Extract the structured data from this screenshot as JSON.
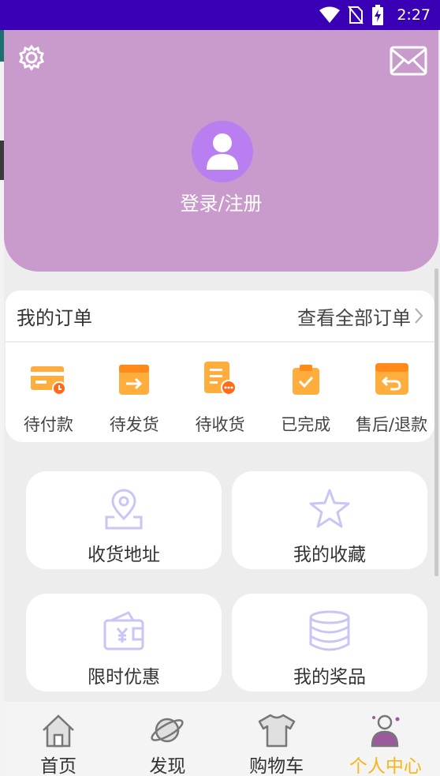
{
  "status_bar": {
    "time": "2:27",
    "icons": [
      "wifi-icon",
      "no-sim-icon",
      "battery-charging-icon"
    ]
  },
  "header": {
    "settings_icon": "gear-icon",
    "mail_icon": "mail-icon",
    "avatar_icon": "user-avatar-icon",
    "login_label": "登录/注册",
    "bg_color": "#c99bcc"
  },
  "orders": {
    "title": "我的订单",
    "view_all": "查看全部订单",
    "items": [
      {
        "label": "待付款",
        "icon": "pending-payment-icon"
      },
      {
        "label": "待发货",
        "icon": "pending-shipment-icon"
      },
      {
        "label": "待收货",
        "icon": "pending-receipt-icon"
      },
      {
        "label": "已完成",
        "icon": "completed-icon"
      },
      {
        "label": "售后/退款",
        "icon": "after-sales-refund-icon"
      }
    ],
    "accent_color": "#ff9a1f"
  },
  "features": [
    {
      "label": "收货地址",
      "icon": "location-pin-icon"
    },
    {
      "label": "我的收藏",
      "icon": "star-icon"
    },
    {
      "label": "限时优惠",
      "icon": "wallet-coupon-icon"
    },
    {
      "label": "我的奖品",
      "icon": "coin-stack-icon"
    }
  ],
  "tabbar": {
    "tabs": [
      {
        "label": "首页",
        "icon": "home-icon",
        "active": false
      },
      {
        "label": "发现",
        "icon": "planet-icon",
        "active": false
      },
      {
        "label": "购物车",
        "icon": "tshirt-icon",
        "active": false
      },
      {
        "label": "个人中心",
        "icon": "profile-icon",
        "active": true
      }
    ],
    "active_color": "#f5b61b"
  }
}
